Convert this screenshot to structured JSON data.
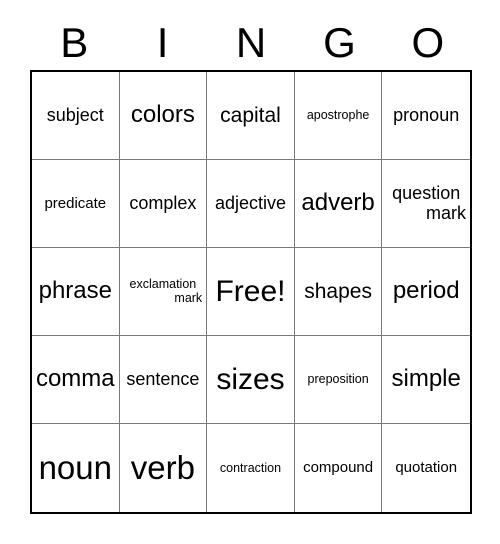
{
  "card": {
    "title": "BINGO",
    "header_letters": [
      "B",
      "I",
      "N",
      "G",
      "O"
    ],
    "free_space_label": "Free!"
  },
  "colors": {
    "text": "#000000",
    "background": "#ffffff",
    "outer_border": "#000000",
    "inner_border": "#7a7a7a"
  },
  "grid": {
    "rows": 5,
    "columns": 5,
    "cells": [
      [
        {
          "text": "subject",
          "size": "md"
        },
        {
          "text": "colors",
          "size": "xl"
        },
        {
          "text": "capital",
          "size": "lg"
        },
        {
          "text": "apostrophe",
          "size": "xs"
        },
        {
          "text": "pronoun",
          "size": "md"
        }
      ],
      [
        {
          "text": "predicate",
          "size": "sm"
        },
        {
          "text": "complex",
          "size": "md"
        },
        {
          "text": "adjective",
          "size": "md"
        },
        {
          "text": "adverb",
          "size": "xl"
        },
        {
          "text": "question mark",
          "size": "md",
          "line1": "question",
          "line2": "mark"
        }
      ],
      [
        {
          "text": "phrase",
          "size": "xl"
        },
        {
          "text": "exclamation mark",
          "size": "xs",
          "line1": "exclamation",
          "line2": "mark"
        },
        {
          "text": "Free!",
          "size": "xxl"
        },
        {
          "text": "shapes",
          "size": "lg"
        },
        {
          "text": "period",
          "size": "xl"
        }
      ],
      [
        {
          "text": "comma",
          "size": "xl"
        },
        {
          "text": "sentence",
          "size": "md"
        },
        {
          "text": "sizes",
          "size": "xxl"
        },
        {
          "text": "preposition",
          "size": "xs"
        },
        {
          "text": "simple",
          "size": "xl"
        }
      ],
      [
        {
          "text": "noun",
          "size": "huge"
        },
        {
          "text": "verb",
          "size": "huge"
        },
        {
          "text": "contraction",
          "size": "xs"
        },
        {
          "text": "compound",
          "size": "sm"
        },
        {
          "text": "quotation",
          "size": "sm"
        }
      ]
    ]
  }
}
